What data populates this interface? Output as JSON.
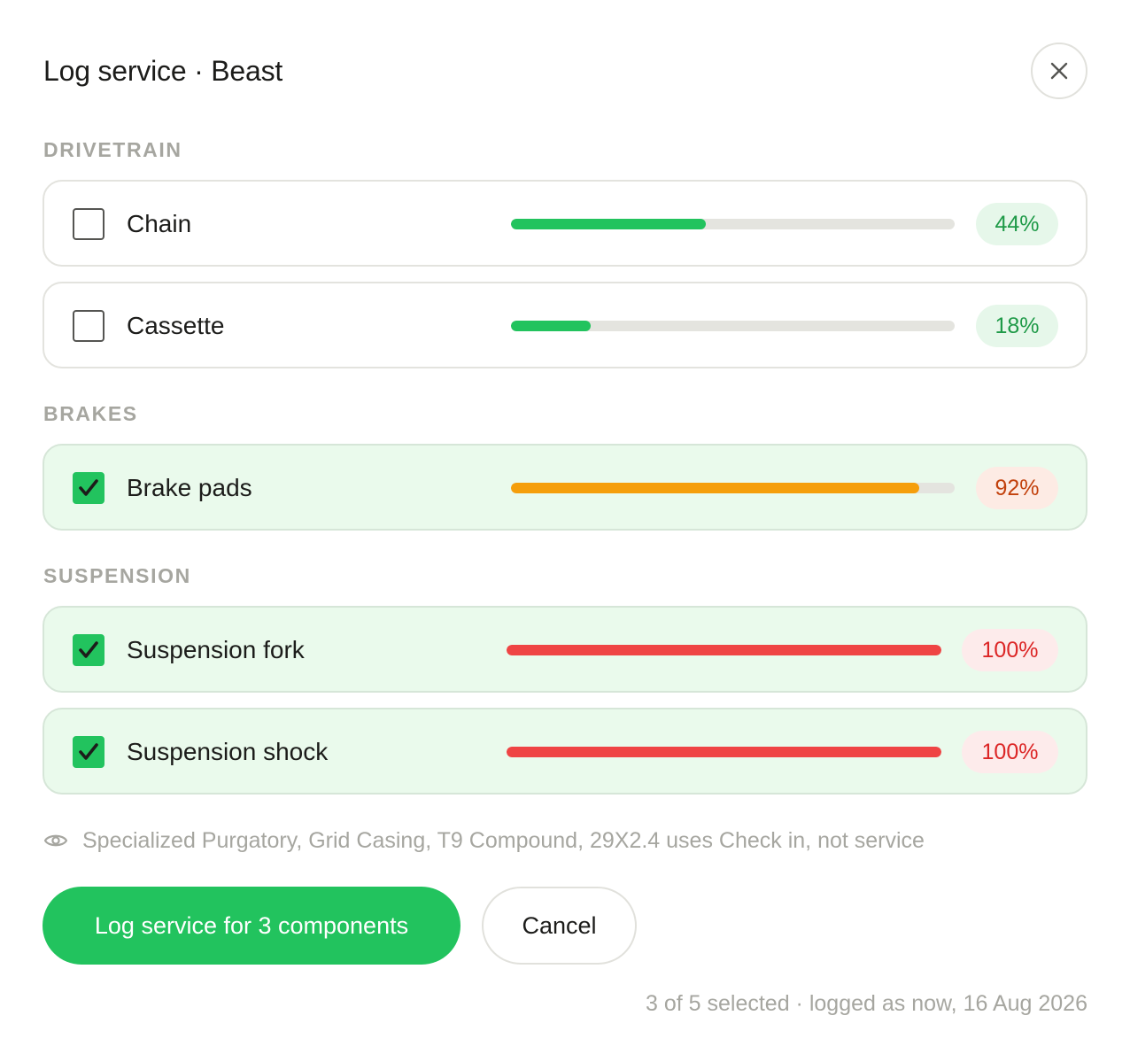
{
  "dialog": {
    "title": "Log service · Beast",
    "close_icon": "close-icon"
  },
  "sections": [
    {
      "label": "DRIVETRAIN",
      "items": [
        {
          "label": "Chain",
          "checked": false,
          "wear_percent": 44,
          "wear_label": "44%",
          "status": "good"
        },
        {
          "label": "Cassette",
          "checked": false,
          "wear_percent": 18,
          "wear_label": "18%",
          "status": "good"
        }
      ]
    },
    {
      "label": "BRAKES",
      "items": [
        {
          "label": "Brake pads",
          "checked": true,
          "wear_percent": 92,
          "wear_label": "92%",
          "status": "warning"
        }
      ]
    },
    {
      "label": "SUSPENSION",
      "items": [
        {
          "label": "Suspension fork",
          "checked": true,
          "wear_percent": 100,
          "wear_label": "100%",
          "status": "overdue"
        },
        {
          "label": "Suspension shock",
          "checked": true,
          "wear_percent": 100,
          "wear_label": "100%",
          "status": "overdue"
        }
      ]
    }
  ],
  "note": {
    "icon": "eye-icon",
    "text": "Specialized Purgatory, Grid Casing, T9 Compound, 29X2.4 uses Check in, not service"
  },
  "actions": {
    "primary_label": "Log service for 3 components",
    "cancel_label": "Cancel"
  },
  "footer": {
    "text": "3 of 5 selected · logged as now, 16 Aug 2026"
  },
  "colors": {
    "accent": "#22c35e",
    "good": "#22c35e",
    "warning": "#f59e0b",
    "overdue": "#ef4444",
    "selected_row_bg": "#eafaec"
  }
}
